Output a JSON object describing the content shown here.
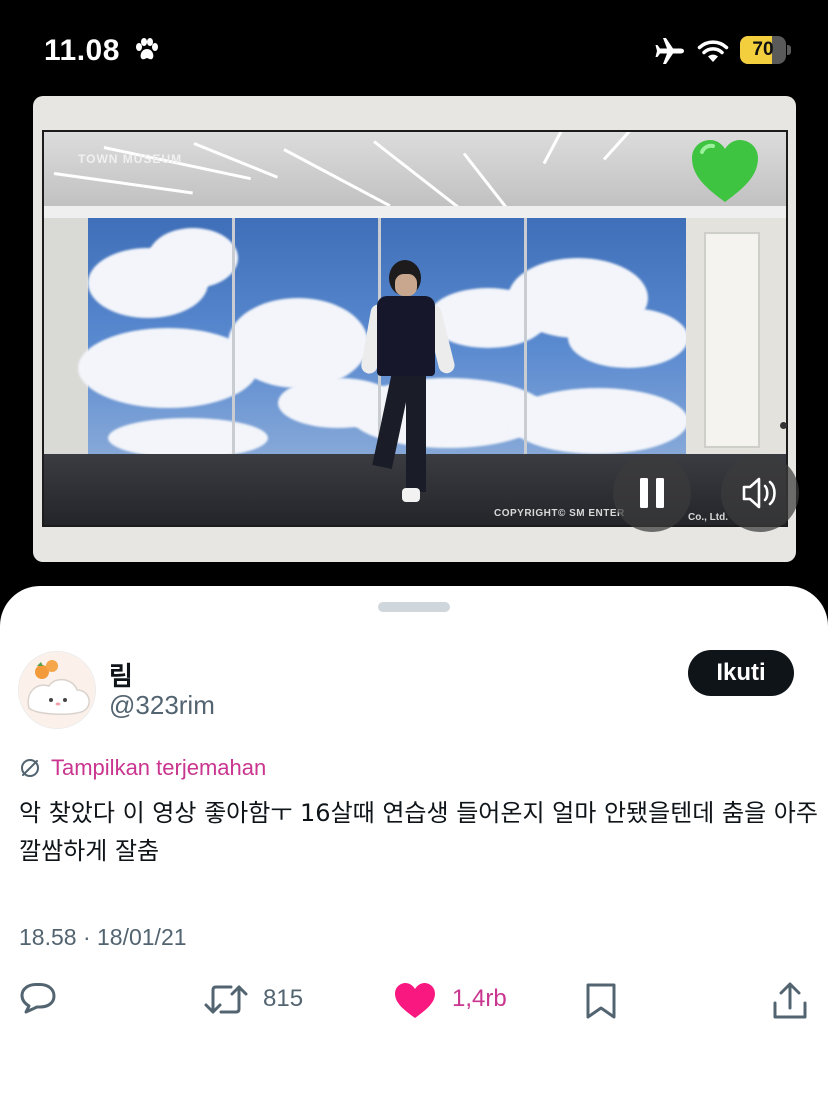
{
  "status_bar": {
    "time": "11.08",
    "battery_percent": 70,
    "battery_label": "70",
    "icons": [
      "paw-icon",
      "airplane-icon",
      "wifi-icon",
      "battery-icon"
    ]
  },
  "video": {
    "watermark_top": "TOWN MUSEUM",
    "watermark_bottom": "COPYRIGHT© SM ENTER",
    "watermark_co": "Co., Ltd.",
    "overlay_icon": "green-heart-icon",
    "controls": [
      "pause-icon",
      "volume-icon"
    ]
  },
  "post": {
    "display_name": "림",
    "handle": "@323rim",
    "follow_label": "Ikuti",
    "translate_label": "Tampilkan terjemahan",
    "text": "악 찾았다 이 영상 좋아함ㅜ 16살때 연습생 들어온지 얼마 안됐을텐데 춤을 아주 깔쌈하게 잘춤",
    "timestamp": "18.58 · 18/01/21"
  },
  "actions": {
    "reply_count": "",
    "retweet_count": "815",
    "like_count": "1,4rb",
    "icons": [
      "reply-icon",
      "retweet-icon",
      "heart-icon",
      "bookmark-icon",
      "share-icon"
    ]
  },
  "colors": {
    "accent_pink": "#c9358f",
    "like_pink": "#f91880",
    "text_primary": "#0f1419",
    "text_secondary": "#536471",
    "battery_yellow": "#f3cf3e"
  }
}
